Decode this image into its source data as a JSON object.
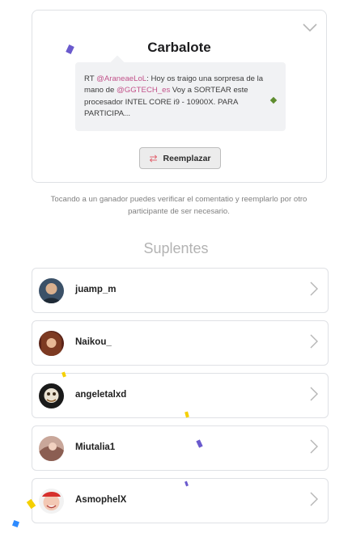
{
  "winner": {
    "name": "Carbalote",
    "tweet": {
      "prefix": "RT ",
      "mention1": "@AraneaeLoL",
      "text1": ": Hoy os traigo una sorpresa de la mano de ",
      "mention2": "@GGTECH_es",
      "text2": " Voy a SORTEAR este procesador INTEL CORE i9 - 10900X. PARA PARTICIPA..."
    },
    "replace_label": "Reemplazar",
    "replace_icon": "swap-arrows-icon"
  },
  "hint": "Tocando a un ganador puedes verificar el comentatio y reemplarlo por otro participante de ser necesario.",
  "alternates": {
    "title": "Suplentes",
    "items": [
      {
        "name": "juamp_m"
      },
      {
        "name": "Naikou_"
      },
      {
        "name": "angeletalxd"
      },
      {
        "name": "Miutalia1"
      },
      {
        "name": "AsmophelX"
      }
    ]
  },
  "colors": {
    "accent_mention": "#c2528a",
    "swap_icon": "#e2646f",
    "confetti": [
      "#6a5acd",
      "#f5d000",
      "#2e8bff",
      "#5e8c2e"
    ]
  }
}
